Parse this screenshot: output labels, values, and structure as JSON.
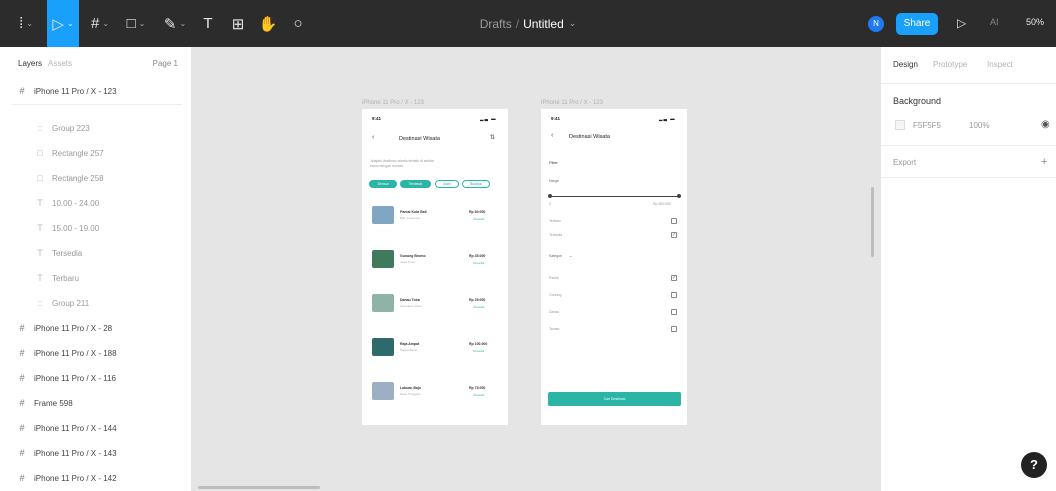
{
  "toolbar": {
    "breadcrumb_folder": "Drafts",
    "breadcrumb_sep": "/",
    "file_name": "Untitled",
    "avatar_initial": "N",
    "share_label": "Share",
    "ai_label": "AI",
    "zoom_label": "50%",
    "accent": "#18a0fb",
    "background": "#2c2c2c",
    "tools": [
      "figma-menu-icon",
      "move-tool-icon",
      "frame-tool-icon",
      "shape-tool-icon",
      "pen-tool-icon",
      "text-tool-icon",
      "resources-icon",
      "hand-tool-icon",
      "comment-icon"
    ]
  },
  "left_panel": {
    "tab_layers": "Layers",
    "tab_assets": "Assets",
    "page_label": "Page 1",
    "layers": [
      {
        "name": "iPhone 11 Pro / X - 123",
        "icon": "#",
        "child": false
      },
      {
        "name": "Group 223",
        "icon": "::",
        "child": true
      },
      {
        "name": "Rectangle 257",
        "icon": "□",
        "child": true
      },
      {
        "name": "Rectangle 258",
        "icon": "□",
        "child": true
      },
      {
        "name": "10.00 - 24.00",
        "icon": "T",
        "child": true
      },
      {
        "name": "15.00 - 19.00",
        "icon": "T",
        "child": true
      },
      {
        "name": "Tersedia",
        "icon": "T",
        "child": true
      },
      {
        "name": "Terbaru",
        "icon": "T",
        "child": true
      },
      {
        "name": "Group 211",
        "icon": "::",
        "child": true
      },
      {
        "name": "iPhone 11 Pro / X - 28",
        "icon": "#",
        "child": false
      },
      {
        "name": "iPhone 11 Pro / X - 188",
        "icon": "#",
        "child": false
      },
      {
        "name": "iPhone 11 Pro / X - 116",
        "icon": "#",
        "child": false
      },
      {
        "name": "Frame 598",
        "icon": "#",
        "child": false
      },
      {
        "name": "iPhone 11 Pro / X - 144",
        "icon": "#",
        "child": false
      },
      {
        "name": "iPhone 11 Pro / X - 143",
        "icon": "#",
        "child": false
      },
      {
        "name": "iPhone 11 Pro / X - 142",
        "icon": "#",
        "child": false
      }
    ]
  },
  "canvas": {
    "frame1": {
      "title": "iPhone 11 Pro / X - 123",
      "time": "9:41",
      "screen_title": "Destinasi Wisata",
      "description_line1": "Jelajahi destinasi wisata terbaik di sekitar",
      "description_line2": "kamu dengan mudah",
      "chips": [
        {
          "label": "Semua",
          "on": true
        },
        {
          "label": "Terdekat",
          "on": true
        },
        {
          "label": "Alam",
          "on": false
        },
        {
          "label": "Budaya",
          "on": false
        }
      ],
      "rows": [
        {
          "name": "Pantai Kuta Bali",
          "sub": "Bali, Indonesia",
          "price": "Rp 50.000",
          "tag": "Tersedia",
          "color": "#7fa7c4"
        },
        {
          "name": "Gunung Bromo",
          "sub": "Jawa Timur",
          "price": "Rp 35.000",
          "tag": "Tersedia",
          "color": "#3f7a5c"
        },
        {
          "name": "Danau Toba",
          "sub": "Sumatera Utara",
          "price": "Rp 25.000",
          "tag": "Tersedia",
          "color": "#8fb3a6"
        },
        {
          "name": "Raja Ampat",
          "sub": "Papua Barat",
          "price": "Rp 100.000",
          "tag": "Tersedia",
          "color": "#2e6a6b"
        },
        {
          "name": "Labuan Bajo",
          "sub": "Nusa Tenggara",
          "price": "Rp 75.000",
          "tag": "Tersedia",
          "color": "#9bb0c4"
        }
      ]
    },
    "frame2": {
      "title": "iPhone 11 Pro / X - 123",
      "time": "9:41",
      "screen_title": "Destinasi Wisata",
      "filter_label": "Filter",
      "harga_label": "Harga",
      "range_min": "0",
      "range_max": "Rp 500.000",
      "options_a": [
        {
          "label": "Terbaru",
          "checked": false
        },
        {
          "label": "Tersedia",
          "checked": true
        }
      ],
      "kategori_label": "Kategori",
      "options_b": [
        {
          "label": "Pantai",
          "checked": true
        },
        {
          "label": "Gunung",
          "checked": false
        },
        {
          "label": "Danau",
          "checked": false
        },
        {
          "label": "Taman",
          "checked": false
        }
      ],
      "apply_label": "Cari Destinasi"
    }
  },
  "right_panel": {
    "tab_design": "Design",
    "tab_prototype": "Prototype",
    "tab_inspect": "Inspect",
    "background_title": "Background",
    "bg_hex": "F5F5F5",
    "bg_opacity": "100%",
    "export_label": "Export",
    "help_label": "?"
  },
  "colors": {
    "teal": "#2bb5a7",
    "canvas_bg": "#e5e5e5",
    "panel_bg": "#ffffff"
  }
}
